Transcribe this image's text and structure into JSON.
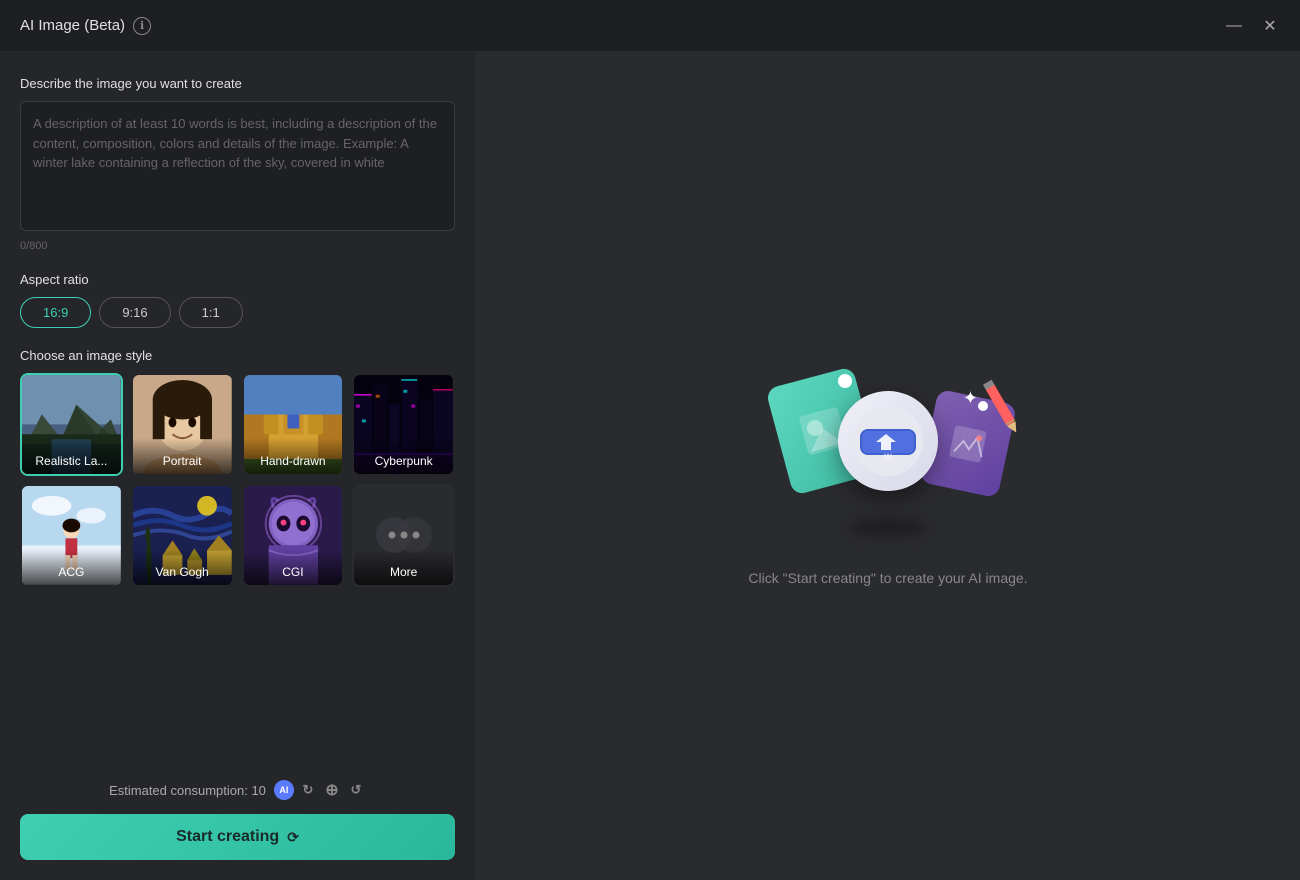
{
  "window": {
    "title": "AI Image (Beta)",
    "info_icon": "ℹ",
    "minimize_icon": "—",
    "close_icon": "✕"
  },
  "left_panel": {
    "description_section": {
      "label": "Describe the image you want to create",
      "placeholder": "A description of at least 10 words is best, including a description of the content, composition, colors and details of the image. Example: A winter lake containing a reflection of the sky, covered in white",
      "char_count": "0/800"
    },
    "aspect_ratio": {
      "label": "Aspect ratio",
      "options": [
        {
          "label": "16:9",
          "active": true
        },
        {
          "label": "9:16",
          "active": false
        },
        {
          "label": "1:1",
          "active": false
        }
      ]
    },
    "image_style": {
      "label": "Choose an image style",
      "styles": [
        {
          "name": "realistic-landscape",
          "label": "Realistic La...",
          "active": true
        },
        {
          "name": "portrait",
          "label": "Portrait",
          "active": false
        },
        {
          "name": "hand-drawn",
          "label": "Hand-drawn",
          "active": false
        },
        {
          "name": "cyberpunk",
          "label": "Cyberpunk",
          "active": false
        },
        {
          "name": "acg",
          "label": "ACG",
          "active": false
        },
        {
          "name": "van-gogh",
          "label": "Van Gogh",
          "active": false
        },
        {
          "name": "cgi",
          "label": "CGI",
          "active": false
        },
        {
          "name": "more",
          "label": "More",
          "active": false
        }
      ]
    },
    "consumption": {
      "label": "Estimated consumption: 10"
    },
    "start_button": {
      "label": "Start creating"
    }
  },
  "right_panel": {
    "hint": "Click \"Start creating\" to create your AI image."
  }
}
